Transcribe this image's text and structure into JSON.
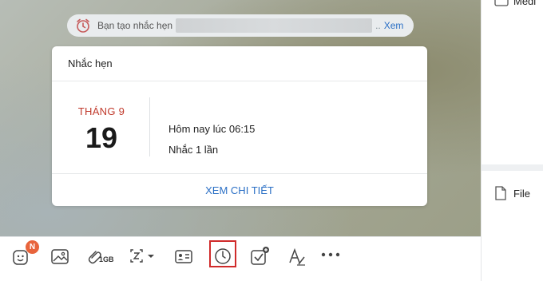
{
  "notice": {
    "text": "Bạn tạo nhắc hẹn",
    "dots": "..",
    "view_link": "Xem"
  },
  "reminder_card": {
    "title": "Nhắc hẹn",
    "month": "THÁNG 9",
    "day": "19",
    "time": "Hôm nay lúc 06:15",
    "repeat": "Nhắc 1 lần",
    "detail_link": "XEM CHI TIẾT"
  },
  "toolbar": {
    "sticker_badge": "N",
    "attach_size": "1GB",
    "icons": [
      "sticker-icon",
      "image-icon",
      "attachment-icon",
      "screenshot-icon",
      "contact-card-icon",
      "reminder-clock-icon",
      "task-icon",
      "text-format-icon",
      "more-icon"
    ]
  },
  "right_panel": {
    "media_label": "Medi",
    "file_label": "File"
  },
  "colors": {
    "accent_blue": "#2a6fc5",
    "month_red": "#c0392b",
    "badge_orange": "#e8643c",
    "highlight_red": "#d02b2b"
  }
}
